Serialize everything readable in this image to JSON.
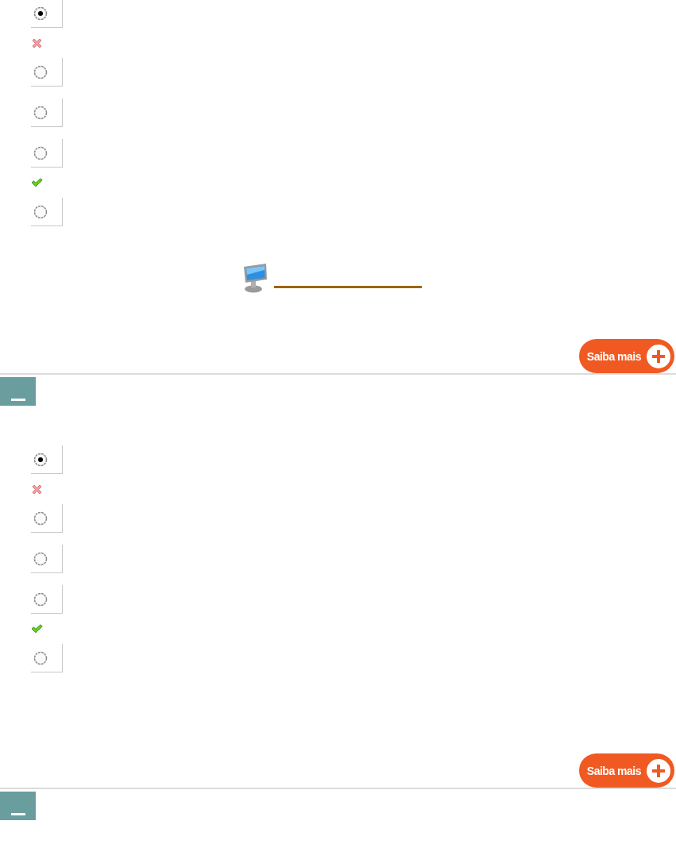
{
  "questions": [
    {
      "options": [
        {
          "selected": true,
          "correct": false
        },
        {
          "selected": false
        },
        {
          "selected": false
        },
        {
          "selected": false,
          "correct": true
        },
        {
          "selected": false
        }
      ],
      "media_link": true,
      "button": "Saiba mais",
      "expanded": true
    },
    {
      "options": [
        {
          "selected": true,
          "correct": false
        },
        {
          "selected": false
        },
        {
          "selected": false
        },
        {
          "selected": false,
          "correct": true
        },
        {
          "selected": false
        }
      ],
      "media_link": false,
      "button": "Saiba mais",
      "expanded": true
    }
  ]
}
